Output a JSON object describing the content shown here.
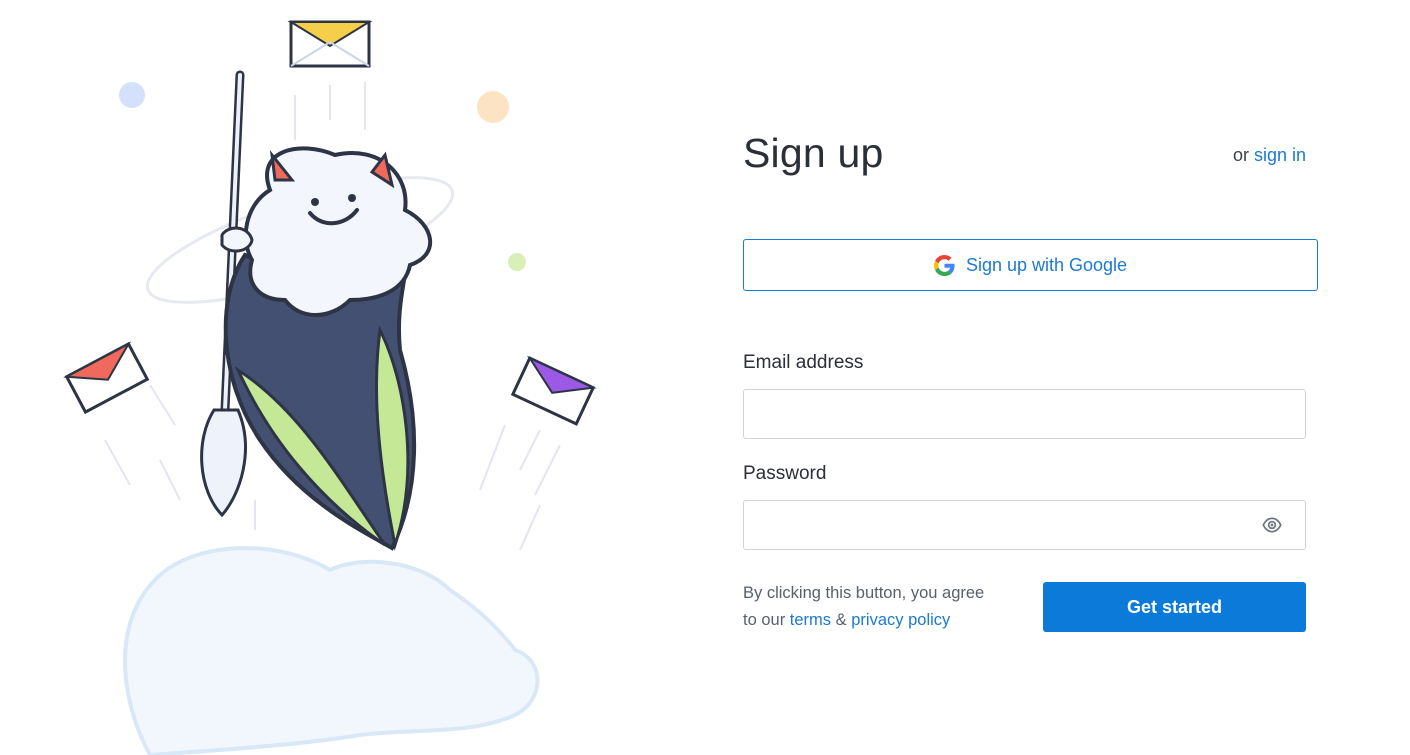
{
  "header": {
    "title": "Sign up",
    "or_text": "or",
    "signin_link": "sign in"
  },
  "google": {
    "label": "Sign up with Google",
    "icon": "google-icon"
  },
  "email": {
    "label": "Email address",
    "value": "",
    "placeholder": ""
  },
  "password": {
    "label": "Password",
    "value": "",
    "placeholder": "",
    "toggle_icon": "eye-icon"
  },
  "terms": {
    "line1": "By clicking this button, you agree",
    "to_our": "to our",
    "terms_link": "terms",
    "amp": "&",
    "privacy_link": "privacy policy"
  },
  "cta": {
    "label": "Get started"
  },
  "colors": {
    "accent": "#0c7ad9",
    "link": "#1b7ad3",
    "title": "#2b2f38"
  }
}
